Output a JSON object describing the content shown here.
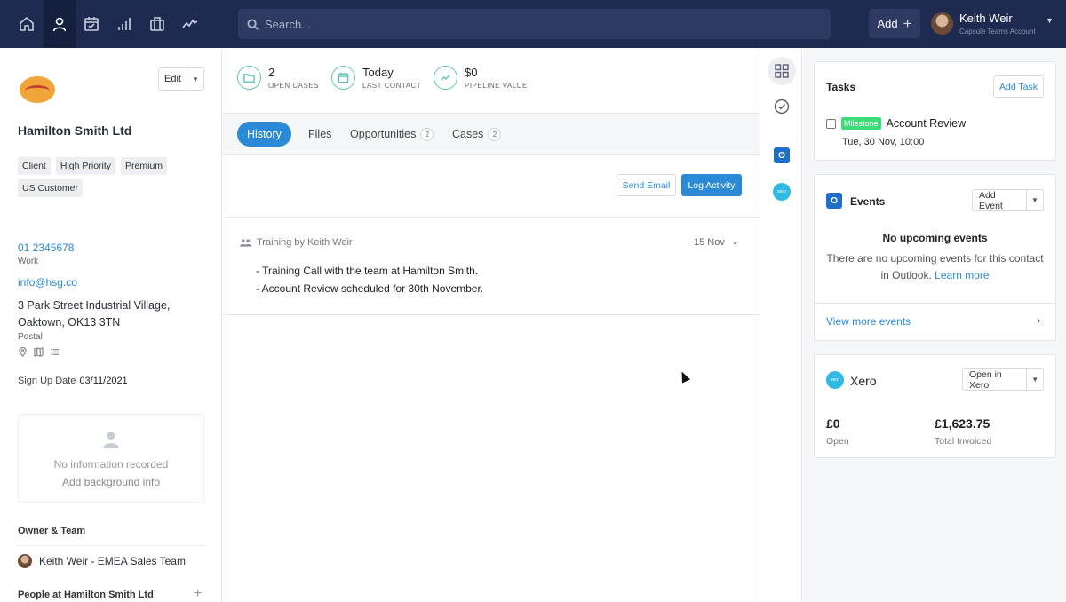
{
  "nav": {
    "icons": [
      "home-icon",
      "person-icon",
      "calendar-check-icon",
      "bar-chart-icon",
      "briefcase-icon",
      "activity-icon"
    ],
    "search_placeholder": "Search...",
    "add_label": "Add",
    "user_name": "Keith Weir",
    "user_account": "Capsule Teams Account"
  },
  "contact": {
    "edit_label": "Edit",
    "name": "Hamilton Smith Ltd",
    "tags": [
      "Client",
      "High Priority",
      "Premium",
      "US Customer"
    ],
    "phone": "01 2345678",
    "phone_type": "Work",
    "email": "info@hsg.co",
    "address_line1": "3 Park Street Industrial Village,",
    "address_line2": "Oaktown, OK13 3TN",
    "address_type": "Postal",
    "signup_label": "Sign Up Date",
    "signup_value": "03/11/2021",
    "background_empty": "No information recorded",
    "background_add": "Add background info",
    "owner_heading": "Owner & Team",
    "owner_value": "Keith Weir - EMEA Sales Team",
    "people_heading": "People at Hamilton Smith Ltd"
  },
  "stats": [
    {
      "value": "2",
      "label": "OPEN CASES",
      "icon": "folder-icon"
    },
    {
      "value": "Today",
      "label": "LAST CONTACT",
      "icon": "calendar-icon"
    },
    {
      "value": "$0",
      "label": "PIPELINE VALUE",
      "icon": "trend-icon"
    }
  ],
  "tabs": [
    {
      "label": "History",
      "active": true
    },
    {
      "label": "Files"
    },
    {
      "label": "Opportunities",
      "count": "2"
    },
    {
      "label": "Cases",
      "count": "2"
    }
  ],
  "actions": {
    "send_email": "Send Email",
    "log_activity": "Log Activity"
  },
  "history": [
    {
      "title": "Training by Keith Weir",
      "date": "15 Nov",
      "lines": [
        "- Training Call with the team at Hamilton Smith.",
        "- Account Review scheduled for 30th November."
      ]
    }
  ],
  "tasks": {
    "title": "Tasks",
    "add_label": "Add Task",
    "items": [
      {
        "badge": "Milestone",
        "name": "Account Review",
        "due": "Tue, 30 Nov, 10:00"
      }
    ]
  },
  "events": {
    "title": "Events",
    "add_label": "Add Event",
    "empty_title": "No upcoming events",
    "empty_text": "There are no upcoming events for this contact",
    "empty_text2": "in Outlook.",
    "learn_more": "Learn more",
    "view_more": "View more events"
  },
  "xero": {
    "title": "Xero",
    "open_label": "Open in Xero",
    "icon_text": "xero",
    "open_amount": "£0",
    "open_amount_label": "Open",
    "invoiced_amount": "£1,623.75",
    "invoiced_label": "Total Invoiced"
  },
  "rail": {
    "outlook_letter": "O"
  },
  "colors": {
    "topbar": "#1e2a4f",
    "accent": "#2b8ad8",
    "teal": "#5cc5b8",
    "milestone": "#3ddc79",
    "xero": "#30b9e3"
  }
}
